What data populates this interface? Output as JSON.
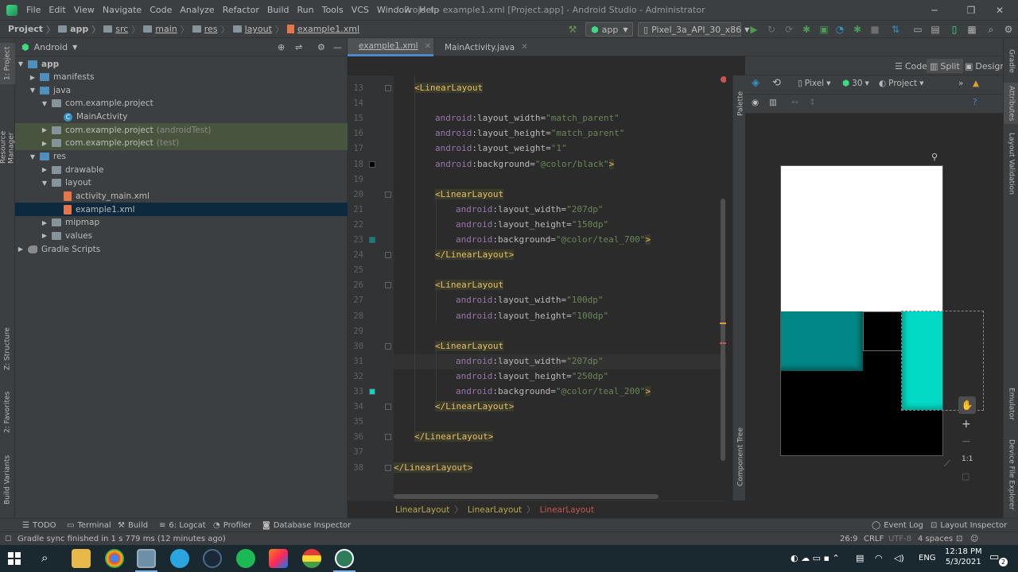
{
  "window": {
    "title": "Project - example1.xml [Project.app] - Android Studio - Administrator",
    "minimize": "─",
    "maximize": "❐",
    "close": "✕"
  },
  "menu": [
    "File",
    "Edit",
    "View",
    "Navigate",
    "Code",
    "Analyze",
    "Refactor",
    "Build",
    "Run",
    "Tools",
    "VCS",
    "Window",
    "Help"
  ],
  "breadcrumbs": [
    "Project",
    "app",
    "src",
    "main",
    "res",
    "layout",
    "example1.xml"
  ],
  "toolbar": {
    "config": "app",
    "device": "Pixel_3a_API_30_x86"
  },
  "project_panel": {
    "view": "Android",
    "tree": [
      {
        "label": "app",
        "depth": 0,
        "arrow": "▼",
        "icon": "folder-blue",
        "bold": true
      },
      {
        "label": "manifests",
        "depth": 1,
        "arrow": "▶",
        "icon": "folder-blue"
      },
      {
        "label": "java",
        "depth": 1,
        "arrow": "▼",
        "icon": "folder-blue"
      },
      {
        "label": "com.example.project",
        "depth": 2,
        "arrow": "▼",
        "icon": "folder"
      },
      {
        "label": "MainActivity",
        "depth": 3,
        "arrow": "",
        "icon": "class"
      },
      {
        "label": "com.example.project",
        "suffix": "(androidTest)",
        "depth": 2,
        "arrow": "▶",
        "icon": "folder",
        "highlight": "green"
      },
      {
        "label": "com.example.project",
        "suffix": "(test)",
        "depth": 2,
        "arrow": "▶",
        "icon": "folder",
        "highlight": "green"
      },
      {
        "label": "res",
        "depth": 1,
        "arrow": "▼",
        "icon": "folder-blue"
      },
      {
        "label": "drawable",
        "depth": 2,
        "arrow": "▶",
        "icon": "folder"
      },
      {
        "label": "layout",
        "depth": 2,
        "arrow": "▼",
        "icon": "folder"
      },
      {
        "label": "activity_main.xml",
        "depth": 3,
        "arrow": "",
        "icon": "xml"
      },
      {
        "label": "example1.xml",
        "depth": 3,
        "arrow": "",
        "icon": "xml",
        "highlight": "selected"
      },
      {
        "label": "mipmap",
        "depth": 2,
        "arrow": "▶",
        "icon": "folder"
      },
      {
        "label": "values",
        "depth": 2,
        "arrow": "▶",
        "icon": "folder"
      },
      {
        "label": "Gradle Scripts",
        "depth": 0,
        "arrow": "▶",
        "icon": "gradle"
      }
    ]
  },
  "left_tabs": [
    "1: Project",
    "Resource Manager",
    "Z: Structure",
    "2: Favorites",
    "Build Variants"
  ],
  "right_tabs": [
    "Gradle",
    "Attributes",
    "Layout Validation",
    "Emulator",
    "Device File Explorer"
  ],
  "editor_tabs": [
    {
      "label": "example1.xml",
      "active": true
    },
    {
      "label": "MainActivity.java",
      "active": false
    }
  ],
  "view_modes": [
    "Code",
    "Split",
    "Design"
  ],
  "code_lines": [
    {
      "n": "13",
      "indent": 1,
      "parts": [
        [
          "tag",
          "<LinearLayout"
        ]
      ]
    },
    {
      "n": "14",
      "indent": 0,
      "parts": []
    },
    {
      "n": "15",
      "indent": 2,
      "parts": [
        [
          "ns",
          "android"
        ],
        [
          "attr",
          ":layout_width="
        ],
        [
          "val",
          "\"match_parent\""
        ]
      ]
    },
    {
      "n": "16",
      "indent": 2,
      "parts": [
        [
          "ns",
          "android"
        ],
        [
          "attr",
          ":layout_height="
        ],
        [
          "val",
          "\"match_parent\""
        ]
      ]
    },
    {
      "n": "17",
      "indent": 2,
      "parts": [
        [
          "ns",
          "android"
        ],
        [
          "attr",
          ":layout_weight="
        ],
        [
          "val",
          "\"1\""
        ]
      ]
    },
    {
      "n": "18",
      "indent": 2,
      "parts": [
        [
          "ns",
          "android"
        ],
        [
          "attr",
          ":background="
        ],
        [
          "val",
          "\"@color/black\""
        ],
        [
          "tag",
          ">"
        ]
      ]
    },
    {
      "n": "19",
      "indent": 0,
      "parts": []
    },
    {
      "n": "20",
      "indent": 2,
      "parts": [
        [
          "tag",
          "<LinearLayout"
        ]
      ]
    },
    {
      "n": "21",
      "indent": 3,
      "parts": [
        [
          "ns",
          "android"
        ],
        [
          "attr",
          ":layout_width="
        ],
        [
          "val",
          "\"207dp\""
        ]
      ]
    },
    {
      "n": "22",
      "indent": 3,
      "parts": [
        [
          "ns",
          "android"
        ],
        [
          "attr",
          ":layout_height="
        ],
        [
          "val",
          "\"150dp\""
        ]
      ]
    },
    {
      "n": "23",
      "indent": 3,
      "parts": [
        [
          "ns",
          "android"
        ],
        [
          "attr",
          ":background="
        ],
        [
          "val",
          "\"@color/teal_700\""
        ],
        [
          "tag",
          ">"
        ]
      ]
    },
    {
      "n": "24",
      "indent": 2,
      "parts": [
        [
          "tag",
          "</LinearLayout>"
        ]
      ]
    },
    {
      "n": "25",
      "indent": 0,
      "parts": []
    },
    {
      "n": "26",
      "indent": 2,
      "parts": [
        [
          "tag",
          "<LinearLayout"
        ]
      ]
    },
    {
      "n": "27",
      "indent": 3,
      "parts": [
        [
          "ns",
          "android"
        ],
        [
          "attr",
          ":layout_width="
        ],
        [
          "val",
          "\"100dp\""
        ]
      ]
    },
    {
      "n": "28",
      "indent": 3,
      "parts": [
        [
          "ns",
          "android"
        ],
        [
          "attr",
          ":layout_height="
        ],
        [
          "val",
          "\"100dp\""
        ]
      ]
    },
    {
      "n": "29",
      "indent": 0,
      "parts": []
    },
    {
      "n": "30",
      "indent": 2,
      "parts": [
        [
          "tag",
          "<LinearLayout"
        ]
      ]
    },
    {
      "n": "31",
      "indent": 3,
      "parts": [
        [
          "ns",
          "android"
        ],
        [
          "attr",
          ":layout_width="
        ],
        [
          "val",
          "\"207dp\""
        ]
      ]
    },
    {
      "n": "32",
      "indent": 3,
      "parts": [
        [
          "ns",
          "android"
        ],
        [
          "attr",
          ":layout_height="
        ],
        [
          "val",
          "\"250dp\""
        ]
      ]
    },
    {
      "n": "33",
      "indent": 3,
      "parts": [
        [
          "ns",
          "android"
        ],
        [
          "attr",
          ":background="
        ],
        [
          "val",
          "\"@color/teal_200\""
        ],
        [
          "tag",
          ">"
        ]
      ]
    },
    {
      "n": "34",
      "indent": 2,
      "parts": [
        [
          "tag",
          "</LinearLayout>"
        ]
      ]
    },
    {
      "n": "35",
      "indent": 0,
      "parts": []
    },
    {
      "n": "36",
      "indent": 1,
      "parts": [
        [
          "tag",
          "</LinearLayout>"
        ]
      ]
    },
    {
      "n": "37",
      "indent": 0,
      "parts": []
    },
    {
      "n": "38",
      "indent": 0,
      "parts": [
        [
          "tag",
          "</LinearLayout>"
        ]
      ]
    }
  ],
  "code_breadcrumb": [
    "LinearLayout",
    "LinearLayout",
    "LinearLayout"
  ],
  "design": {
    "palette_label": "Palette",
    "component_tree_label": "Component Tree",
    "device": "Pixel",
    "api": "30",
    "theme": "Project",
    "zoom_label": "1:1"
  },
  "bottom_tools": [
    {
      "label": "TODO",
      "icon": "list-icon"
    },
    {
      "label": "Terminal",
      "icon": "terminal-icon"
    },
    {
      "label": "Build",
      "icon": "hammer-icon"
    },
    {
      "label": "6: Logcat",
      "icon": "logcat-icon"
    },
    {
      "label": "Profiler",
      "icon": "profiler-icon"
    },
    {
      "label": "Database Inspector",
      "icon": "database-icon"
    }
  ],
  "bottom_right_tools": [
    "Event Log",
    "Layout Inspector"
  ],
  "status": {
    "message": "Gradle sync finished in 1 s 779 ms (12 minutes ago)",
    "position": "26:9",
    "line_sep": "CRLF",
    "encoding": "UTF-8",
    "indent": "4 spaces"
  },
  "taskbar": {
    "time": "12:18 PM",
    "date": "5/3/2021",
    "lang": "ENG",
    "notifications": "2"
  },
  "colors": {
    "teal_700": "#018786",
    "teal_200": "#03dac5",
    "black": "#000000"
  }
}
